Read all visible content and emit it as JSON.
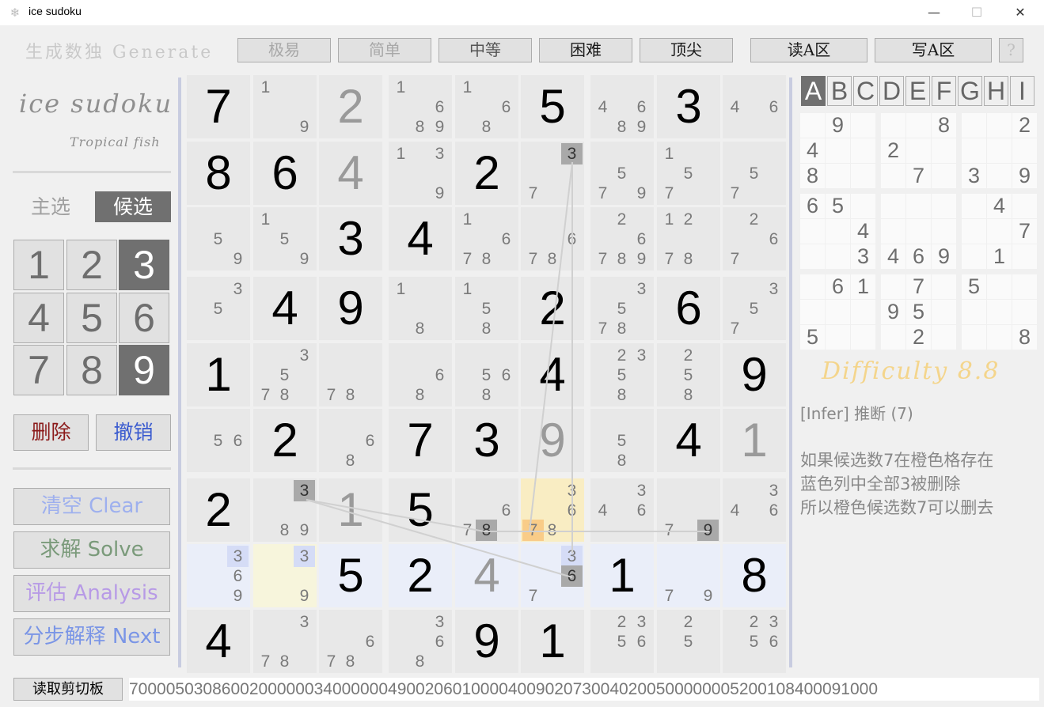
{
  "window": {
    "title": "ice sudoku",
    "controls": {
      "minimize": "—",
      "maximize": "☐",
      "close": "✕"
    }
  },
  "toolbar": {
    "title": "生成数独 Generate",
    "buttons": [
      "极易",
      "简单",
      "中等",
      "困难",
      "顶尖",
      "读A区",
      "写A区",
      "?"
    ]
  },
  "left_panel": {
    "brand": "ice sudoku",
    "subtitle": "Tropical fish",
    "mode_main": "主选",
    "mode_candidate": "候选",
    "numpad": [
      "1",
      "2",
      "3",
      "4",
      "5",
      "6",
      "7",
      "8",
      "9"
    ],
    "numpad_active": [
      3,
      9
    ],
    "delete_label": "删除",
    "undo_label": "撤销",
    "clear_label": "清空 Clear",
    "solve_label": "求解 Solve",
    "analysis_label": "评估 Analysis",
    "next_label": "分步解释 Next"
  },
  "colors": {
    "blue_row": "#eaeef9",
    "yellow_cell": "#f7f5dc",
    "orange_cell": "#f9edc3",
    "highlight_grey": "#a9a9a9",
    "highlight_blue": "#d5dcf6",
    "highlight_orange": "#f9cc88",
    "delete_red": "#8b1a1a",
    "undo_blue": "#3a5bcf",
    "clear_blue": "#9eb0ee",
    "solve_green": "#7a9a7a",
    "analysis_purple": "#b79ae6",
    "next_blue": "#7a95e6",
    "difficulty_gold": "#f4d58c"
  },
  "grid": [
    [
      {
        "v": "7"
      },
      {
        "c": [
          1,
          9
        ]
      },
      {
        "v": "2",
        "u": true
      },
      {
        "c": [
          1,
          6,
          8,
          9
        ]
      },
      {
        "c": [
          1,
          6,
          8
        ]
      },
      {
        "v": "5"
      },
      {
        "c": [
          4,
          6,
          8,
          9
        ]
      },
      {
        "v": "3"
      },
      {
        "c": [
          4,
          6
        ]
      }
    ],
    [
      {
        "v": "8"
      },
      {
        "v": "6"
      },
      {
        "v": "4",
        "u": true
      },
      {
        "c": [
          1,
          3,
          9
        ]
      },
      {
        "v": "2"
      },
      {
        "c": [
          3,
          7
        ],
        "hg": [
          3
        ]
      },
      {
        "c": [
          5,
          7,
          9
        ]
      },
      {
        "c": [
          1,
          5,
          7
        ]
      },
      {
        "c": [
          5,
          7
        ]
      }
    ],
    [
      {
        "c": [
          5,
          9
        ]
      },
      {
        "c": [
          1,
          5,
          9
        ]
      },
      {
        "v": "3"
      },
      {
        "v": "4"
      },
      {
        "c": [
          1,
          6,
          7,
          8
        ]
      },
      {
        "c": [
          6,
          7,
          8
        ]
      },
      {
        "c": [
          2,
          6,
          7,
          8,
          9
        ]
      },
      {
        "c": [
          1,
          2,
          8,
          7
        ]
      },
      {
        "c": [
          2,
          6,
          7
        ]
      }
    ],
    [
      {
        "c": [
          3,
          5
        ]
      },
      {
        "v": "4"
      },
      {
        "v": "9"
      },
      {
        "c": [
          1,
          8
        ]
      },
      {
        "c": [
          1,
          5,
          8
        ]
      },
      {
        "v": "2"
      },
      {
        "c": [
          3,
          5,
          7,
          8
        ]
      },
      {
        "v": "6"
      },
      {
        "c": [
          3,
          5,
          7
        ]
      }
    ],
    [
      {
        "v": "1"
      },
      {
        "c": [
          3,
          5,
          7,
          8
        ]
      },
      {
        "c": [
          7,
          8
        ]
      },
      {
        "c": [
          6,
          8
        ]
      },
      {
        "c": [
          5,
          6,
          8
        ]
      },
      {
        "v": "4"
      },
      {
        "c": [
          2,
          3,
          5,
          8
        ]
      },
      {
        "c": [
          2,
          5,
          8
        ]
      },
      {
        "v": "9"
      }
    ],
    [
      {
        "c": [
          5,
          6
        ]
      },
      {
        "v": "2"
      },
      {
        "c": [
          6,
          8
        ]
      },
      {
        "v": "7"
      },
      {
        "v": "3"
      },
      {
        "v": "9",
        "u": true
      },
      {
        "c": [
          5,
          8
        ]
      },
      {
        "v": "4"
      },
      {
        "v": "1",
        "u": true
      }
    ],
    [
      {
        "v": "2"
      },
      {
        "c": [
          3,
          8,
          9
        ],
        "hg": [
          3
        ]
      },
      {
        "v": "1",
        "u": true
      },
      {
        "v": "5"
      },
      {
        "c": [
          6,
          7,
          8
        ],
        "hg": [
          8
        ]
      },
      {
        "c": [
          3,
          6,
          7,
          8
        ],
        "ho": [
          7
        ],
        "bg": "orange"
      },
      {
        "c": [
          3,
          4,
          6
        ]
      },
      {
        "c": [
          7,
          9
        ],
        "hg": [
          9
        ]
      },
      {
        "c": [
          3,
          4,
          6
        ]
      }
    ],
    [
      {
        "c": [
          3,
          6,
          9
        ],
        "hb": [
          3
        ],
        "bg": "blue"
      },
      {
        "c": [
          3,
          9
        ],
        "hb": [
          3
        ],
        "bg": "yellow"
      },
      {
        "v": "5",
        "bg": "blue"
      },
      {
        "v": "2",
        "bg": "blue"
      },
      {
        "v": "4",
        "u": true,
        "bg": "blue"
      },
      {
        "c": [
          3,
          6,
          7
        ],
        "hb": [
          3
        ],
        "hg": [
          6
        ],
        "bg": "blue"
      },
      {
        "v": "1",
        "bg": "blue"
      },
      {
        "c": [
          7,
          9
        ],
        "bg": "blue"
      },
      {
        "v": "8",
        "bg": "blue"
      }
    ],
    [
      {
        "v": "4"
      },
      {
        "c": [
          3,
          7,
          8
        ]
      },
      {
        "c": [
          6,
          7,
          8
        ]
      },
      {
        "c": [
          3,
          6,
          8
        ]
      },
      {
        "v": "9"
      },
      {
        "v": "1"
      },
      {
        "c": [
          2,
          3,
          5,
          6
        ]
      },
      {
        "c": [
          2,
          5
        ]
      },
      {
        "c": [
          2,
          3,
          5,
          6
        ]
      }
    ]
  ],
  "right_panel": {
    "tabs": [
      "A",
      "B",
      "C",
      "D",
      "E",
      "F",
      "G",
      "H",
      "I"
    ],
    "active_tab": "A",
    "mini_grid": [
      [
        "",
        "9",
        "",
        "",
        "",
        "8",
        "",
        "",
        "2"
      ],
      [
        "4",
        "",
        "",
        "2",
        "",
        "",
        "",
        "",
        ""
      ],
      [
        "8",
        "",
        "",
        "",
        "7",
        "",
        "3",
        "",
        "9"
      ],
      [
        "6",
        "5",
        "",
        "",
        "",
        "",
        "",
        "4",
        ""
      ],
      [
        "",
        "",
        "4",
        "",
        "",
        "",
        "",
        "",
        "7"
      ],
      [
        "",
        "",
        "3",
        "4",
        "6",
        "9",
        "",
        "1",
        ""
      ],
      [
        "",
        "6",
        "1",
        "",
        "7",
        "",
        "5",
        "",
        ""
      ],
      [
        "",
        "",
        "",
        "9",
        "5",
        "",
        "",
        "",
        ""
      ],
      [
        "5",
        "",
        "",
        "",
        "2",
        "",
        "",
        "",
        "8"
      ]
    ],
    "difficulty": "Difficulty 8.8",
    "infer_title": "[Infer] 推断 (7)",
    "explanation": [
      "如果候选数7在橙色格存在",
      "蓝色列中全部3被删除",
      "所以橙色候选数7可以删去"
    ]
  },
  "bottom": {
    "clipboard_button": "读取剪切板",
    "puzzle_string": "700005030860020000003400000049002060100004009020730040200500000005200108400091000"
  }
}
